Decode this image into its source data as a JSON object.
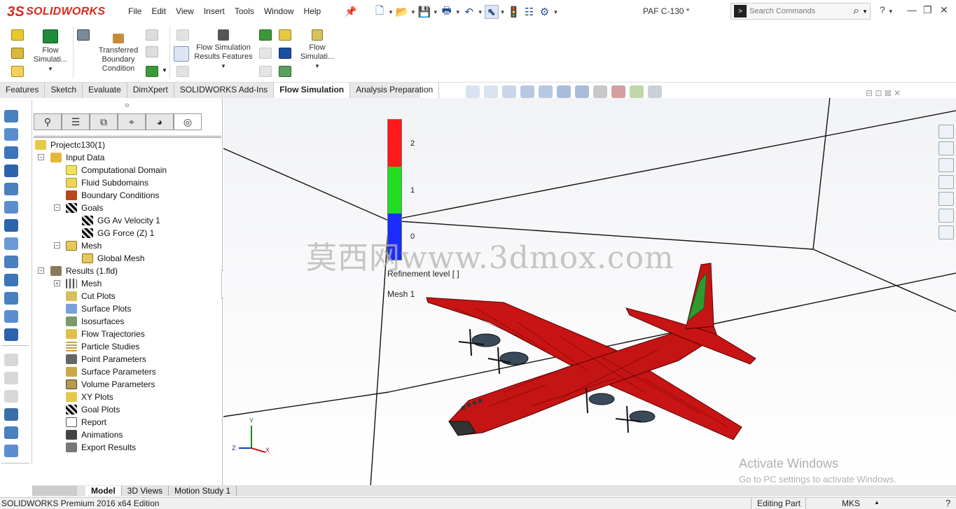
{
  "app": {
    "logo_text": "SOLIDWORKS",
    "logo_ds": "3S",
    "document_title": "PAF C-130 *",
    "menu": [
      "File",
      "Edit",
      "View",
      "Insert",
      "Tools",
      "Window",
      "Help"
    ],
    "search_placeholder": "Search Commands",
    "help_label": "?"
  },
  "ribbon": {
    "flow_sim_1": "Flow Simulati...",
    "transferred": "Transferred Boundary Condition",
    "results_features": "Flow Simulation Results Features",
    "flow_sim_2": "Flow Simulati..."
  },
  "command_tabs": [
    "Features",
    "Sketch",
    "Evaluate",
    "DimXpert",
    "SOLIDWORKS Add-Ins",
    "Flow Simulation",
    "Analysis Preparation"
  ],
  "active_command_tab": "Flow Simulation",
  "tree": {
    "root": "Projectc130(1)",
    "input_data": "Input Data",
    "computational_domain": "Computational Domain",
    "fluid_subdomains": "Fluid Subdomains",
    "boundary_conditions": "Boundary Conditions",
    "goals": "Goals",
    "goal_1": "GG Av Velocity 1",
    "goal_2": "GG Force (Z) 1",
    "mesh": "Mesh",
    "global_mesh": "Global Mesh",
    "results": "Results (1.fld)",
    "results_mesh": "Mesh",
    "cut_plots": "Cut Plots",
    "surface_plots": "Surface Plots",
    "isosurfaces": "Isosurfaces",
    "flow_trajectories": "Flow Trajectories",
    "particle_studies": "Particle Studies",
    "point_parameters": "Point Parameters",
    "surface_parameters": "Surface Parameters",
    "volume_parameters": "Volume Parameters",
    "xy_plots": "XY Plots",
    "goal_plots": "Goal Plots",
    "report": "Report",
    "animations": "Animations",
    "export_results": "Export Results"
  },
  "legend": {
    "ticks": [
      "2",
      "1",
      "0"
    ],
    "title": "Refinement level [ ]",
    "colors": [
      "#ff1a1a",
      "#22dd22",
      "#1a2cff"
    ]
  },
  "viewport": {
    "mesh_label": "Mesh 1",
    "watermark": "莫西网www.3dmox.com",
    "activate_title": "Activate Windows",
    "activate_sub": "Go to PC settings to activate Windows.",
    "triad": {
      "x": "X",
      "y": "Y",
      "z": "Z"
    }
  },
  "bottom_tabs": [
    "Model",
    "3D Views",
    "Motion Study 1"
  ],
  "active_bottom_tab": "Model",
  "status": {
    "edition": "SOLIDWORKS Premium 2016 x64 Edition",
    "mode": "Editing Part",
    "units": "MKS"
  }
}
